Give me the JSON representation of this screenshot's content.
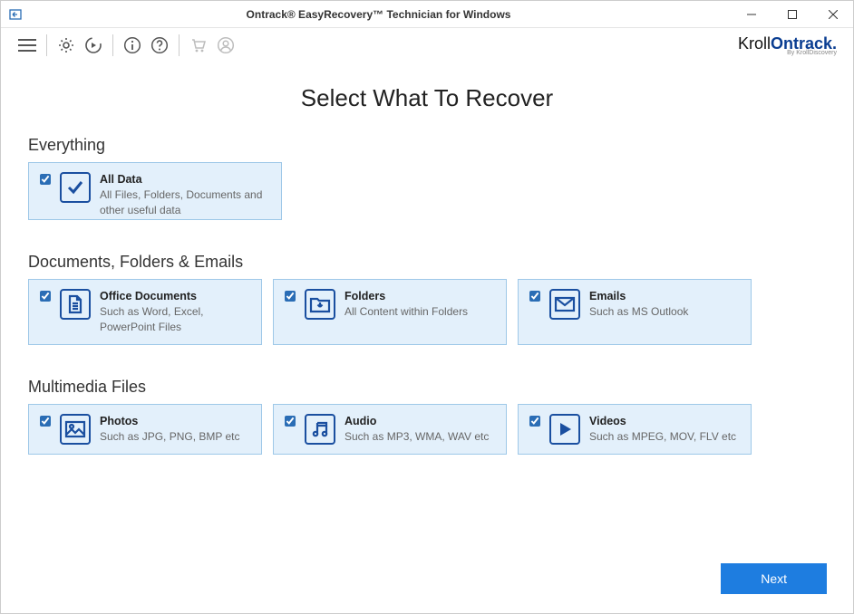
{
  "window": {
    "title": "Ontrack® EasyRecovery™ Technician for Windows"
  },
  "brand": {
    "part1": "Kroll",
    "part2": "Ontrack",
    "sub": "By KrollDiscovery"
  },
  "page": {
    "heading": "Select What To Recover"
  },
  "sections": {
    "everything": {
      "label": "Everything",
      "card": {
        "title": "All Data",
        "desc": "All Files, Folders, Documents and other useful data"
      }
    },
    "docs": {
      "label": "Documents, Folders & Emails",
      "cards": [
        {
          "title": "Office Documents",
          "desc": "Such as Word, Excel, PowerPoint Files"
        },
        {
          "title": "Folders",
          "desc": "All Content within Folders"
        },
        {
          "title": "Emails",
          "desc": "Such as MS Outlook"
        }
      ]
    },
    "media": {
      "label": "Multimedia Files",
      "cards": [
        {
          "title": "Photos",
          "desc": "Such as JPG, PNG, BMP etc"
        },
        {
          "title": "Audio",
          "desc": "Such as MP3, WMA, WAV etc"
        },
        {
          "title": "Videos",
          "desc": "Such as MPEG, MOV, FLV etc"
        }
      ]
    }
  },
  "footer": {
    "next": "Next"
  }
}
